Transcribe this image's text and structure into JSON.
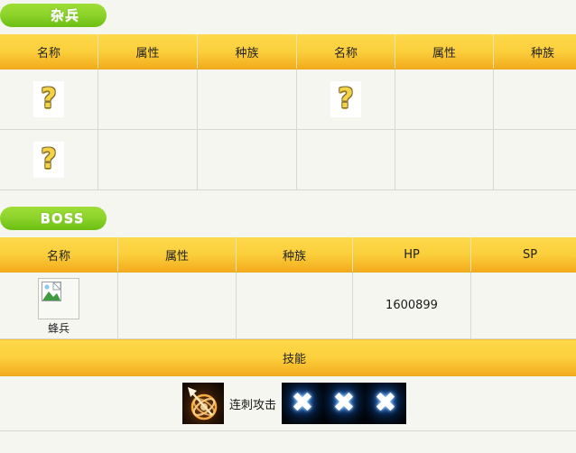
{
  "sections": {
    "mobs": {
      "badge_label": "杂兵",
      "columns": [
        "名称",
        "属性",
        "种族",
        "名称",
        "属性",
        "种族"
      ],
      "rows": [
        [
          {
            "type": "qmark",
            "value": "?"
          },
          {
            "type": "text",
            "value": ""
          },
          {
            "type": "text",
            "value": ""
          },
          {
            "type": "qmark",
            "value": "?"
          },
          {
            "type": "text",
            "value": ""
          },
          {
            "type": "text",
            "value": ""
          }
        ],
        [
          {
            "type": "qmark",
            "value": "?"
          },
          {
            "type": "text",
            "value": ""
          },
          {
            "type": "text",
            "value": ""
          },
          {
            "type": "text",
            "value": ""
          },
          {
            "type": "text",
            "value": ""
          },
          {
            "type": "text",
            "value": ""
          }
        ]
      ]
    },
    "boss": {
      "badge_label": "BOSS",
      "columns": [
        "名称",
        "属性",
        "种族",
        "HP",
        "SP"
      ],
      "row": {
        "name": "蜂兵",
        "portrait_icon": "broken-image-icon",
        "attribute": "",
        "race": "",
        "hp": "1600899",
        "sp": ""
      },
      "skills_header": "技能",
      "skills": [
        {
          "icon": "spiral-thrust-icon",
          "label": "连刺攻击"
        },
        {
          "icon": "x-mark-icon",
          "label": ""
        },
        {
          "icon": "x-mark-icon",
          "label": ""
        },
        {
          "icon": "x-mark-icon",
          "label": ""
        }
      ],
      "x_glyph": "✖"
    }
  },
  "colors": {
    "badge_green_top": "#9ede36",
    "badge_green_bottom": "#6cbf12",
    "header_yellow_top": "#fdd94b",
    "header_yellow_bottom": "#f3ab1d",
    "page_background": "#f5f6f0"
  }
}
